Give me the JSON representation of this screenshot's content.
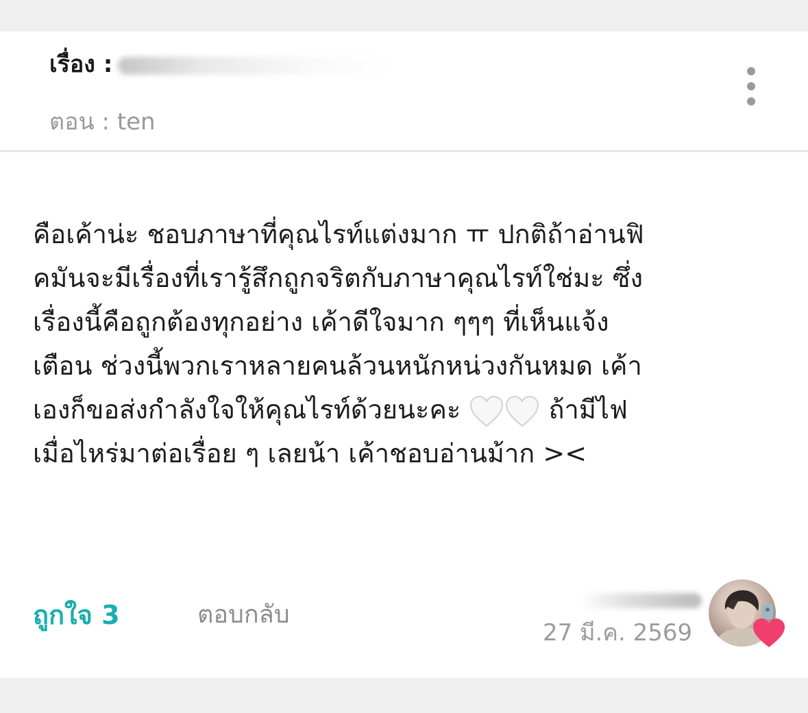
{
  "header": {
    "story_label": "เรื่อง :",
    "episode_text": "ตอน : ten"
  },
  "comment": {
    "lines": [
      "คือเค้าน่ะ ชอบภาษาที่คุณไรท์แต่งมาก ㅠ ปกติถ้าอ่านฟิ",
      "คมันจะมีเรื่องที่เรารู้สึกถูกจริตกับภาษาคุณไรท์ใช่มะ ซึ่ง",
      "เรื่องนี้คือถูกต้องทุกอย่าง เค้าดีใจมาก ๆๆๆ ที่เห็นแจ้ง",
      "เตือน ช่วงนี้พวกเราหลายคนล้วนหนักหน่วงกันหมด เค้า",
      "เองก็ขอส่งกำลังใจให้คุณไรท์ด้วยนะคะ",
      "ถ้ามีไฟ",
      "เมื่อไหร่มาต่อเรื่อย ๆ เลยน้า เค้าชอบอ่านม้าก ><"
    ]
  },
  "footer": {
    "like_label": "ถูกใจ 3",
    "reply_label": "ตอบกลับ",
    "date": "27 มี.ค. 2569"
  },
  "colors": {
    "accent_teal": "#1aaeb0",
    "heart_pink": "#ef3f6e",
    "muted_gray": "#9a9a9a"
  },
  "icons": {
    "menu": "kebab-menu-icon",
    "white_heart": "white-heart-emoji",
    "badge": "pink-heart-icon"
  }
}
